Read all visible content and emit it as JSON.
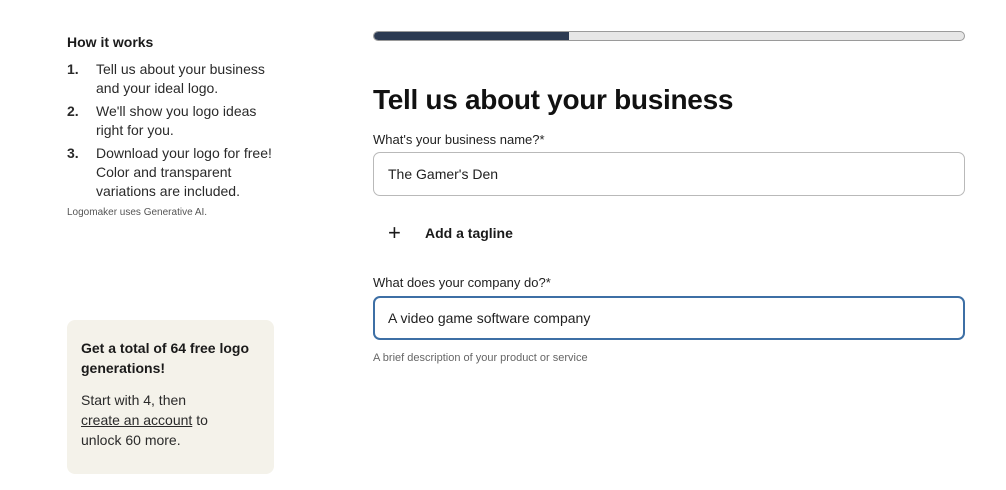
{
  "sidebar": {
    "title": "How it works",
    "steps": [
      {
        "num": "1.",
        "text": "Tell us about your business and your ideal logo."
      },
      {
        "num": "2.",
        "text": "We'll show you logo ideas right for you."
      },
      {
        "num": "3.",
        "text": "Download your logo for free! Color and transparent variations are included."
      }
    ],
    "ai_note": "Logomaker uses Generative AI."
  },
  "promo": {
    "title": "Get a total of 64 free logo generations!",
    "body_prefix": "Start with 4, then",
    "link": "create an account",
    "body_suffix": "to unlock 60 more."
  },
  "progress": {
    "fraction": 0.33
  },
  "form": {
    "heading": "Tell us about your business",
    "business_name_label": "What's your business name?*",
    "business_name_value": "The Gamer's Den",
    "add_tagline_label": "Add a tagline",
    "company_do_label": "What does your company do?*",
    "company_do_value": "A video game software company",
    "company_do_hint": "A brief description of your product or service"
  },
  "colors": {
    "progress_fill": "#2c3a52",
    "focus_border": "#3d6fa5",
    "promo_bg": "#f4f2ea"
  }
}
